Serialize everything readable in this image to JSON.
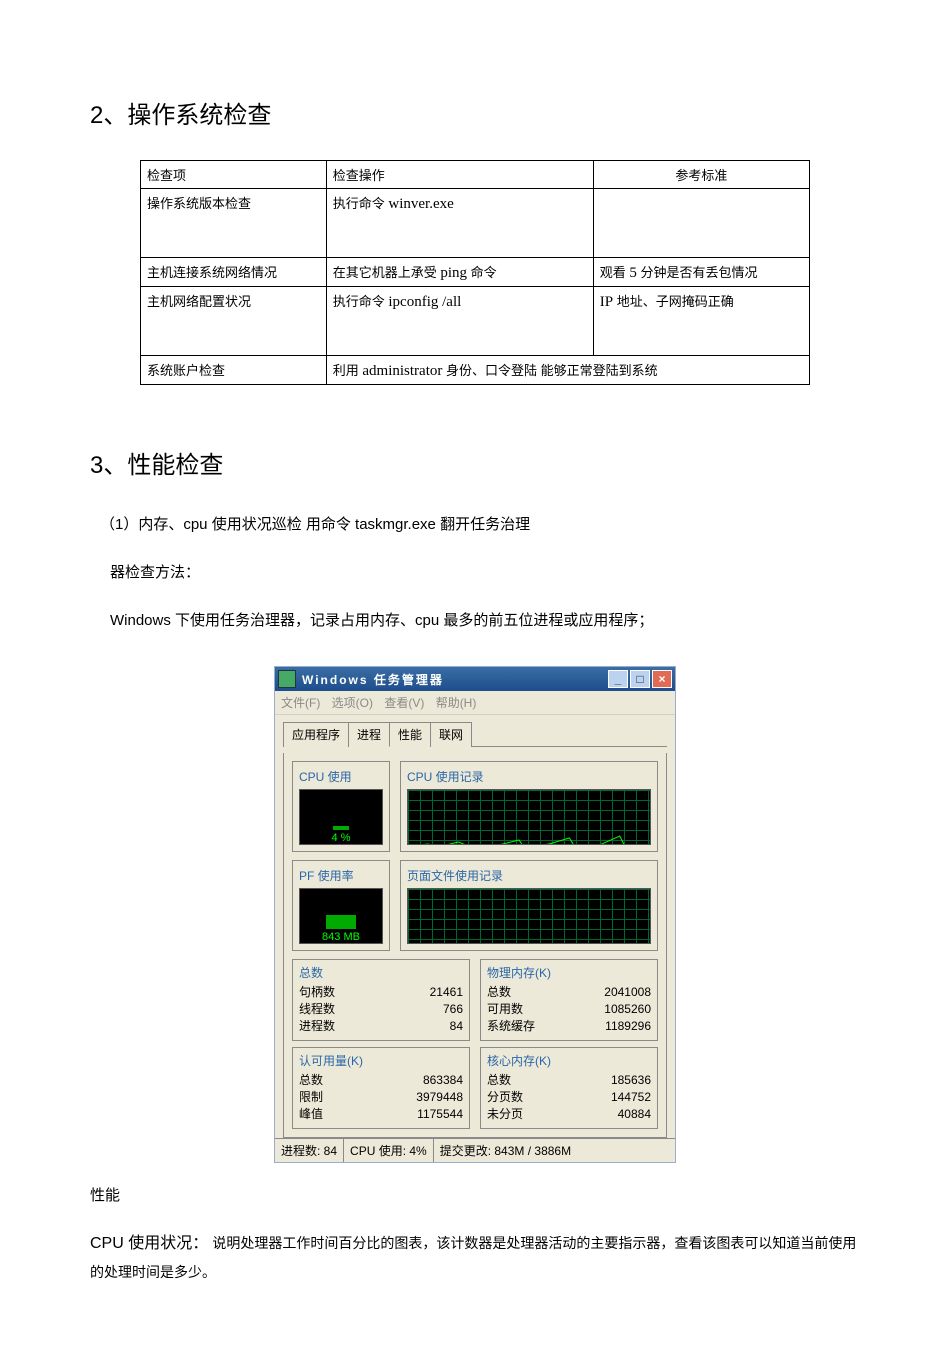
{
  "sec2_title": "2、操作系统检查",
  "sec3_title": "3、性能检查",
  "table": {
    "h1": "检查项",
    "h2": "检查操作",
    "h3": "参考标准",
    "r1c1": "操作系统版本检查",
    "r1c2a": "执行命令 ",
    "r1c2b": "winver.exe",
    "r1c3": "",
    "r2c1": "主机连接系统网络情况",
    "r2c2a": "在其它机器上承受 ",
    "r2c2b": "ping",
    "r2c2c": " 命令",
    "r2c3a": "观看 ",
    "r2c3b": "5",
    "r2c3c": " 分钟是否有丢包情况",
    "r3c1": "主机网络配置状况",
    "r3c2a": "执行命令 ",
    "r3c2b": "ipconfig /all",
    "r3c3a": "IP",
    "r3c3b": " 地址、子网掩码正确",
    "r4c1": "系统账户检查",
    "r4c2a": "利用 ",
    "r4c2b": "administrator",
    "r4c2c": " 身份、口令登陆 能够正常登陆到系统",
    "r4c3": ""
  },
  "p1a": "（1）内存、cpu 使用状况巡检  用命令 taskmgr.exe 翻开任务治理",
  "p1b": "器检查方法：",
  "p2": "Windows  下使用任务治理器，记录占用内存、cpu 最多的前五位进程或应用程序；",
  "perf_label": "性能",
  "cpu_desc_a": "CPU  使用状况：",
  "cpu_desc_b": "说明处理器工作时间百分比的图表，该计数器是处理器活动的主要指示器，查看该图表可以知道当前使用的处理时间是多少。",
  "tm": {
    "title": "Windows 任务管理器",
    "menu": {
      "file": "文件(F)",
      "options": "选项(O)",
      "view": "查看(V)",
      "help": "帮助(H)"
    },
    "tabs": {
      "apps": "应用程序",
      "procs": "进程",
      "perf": "性能",
      "net": "联网"
    },
    "cpu_usage_lbl": "CPU 使用",
    "cpu_hist_lbl": "CPU 使用记录",
    "cpu_val": "4 %",
    "pf_lbl": "PF 使用率",
    "pf_hist_lbl": "页面文件使用记录",
    "pf_val": "843 MB",
    "totals": {
      "title": "总数",
      "handles_l": "句柄数",
      "handles_v": "21461",
      "threads_l": "线程数",
      "threads_v": "766",
      "procs_l": "进程数",
      "procs_v": "84"
    },
    "phys": {
      "title": "物理内存(K)",
      "total_l": "总数",
      "total_v": "2041008",
      "avail_l": "可用数",
      "avail_v": "1085260",
      "cache_l": "系统缓存",
      "cache_v": "1189296"
    },
    "commit": {
      "title": "认可用量(K)",
      "total_l": "总数",
      "total_v": "863384",
      "limit_l": "限制",
      "limit_v": "3979448",
      "peak_l": "峰值",
      "peak_v": "1175544"
    },
    "kernel": {
      "title": "核心内存(K)",
      "total_l": "总数",
      "total_v": "185636",
      "paged_l": "分页数",
      "paged_v": "144752",
      "nonpaged_l": "未分页",
      "nonpaged_v": "40884"
    },
    "status": {
      "procs": "进程数: 84",
      "cpu": "CPU 使用: 4%",
      "commit": "提交更改: 843M / 3886M"
    }
  }
}
